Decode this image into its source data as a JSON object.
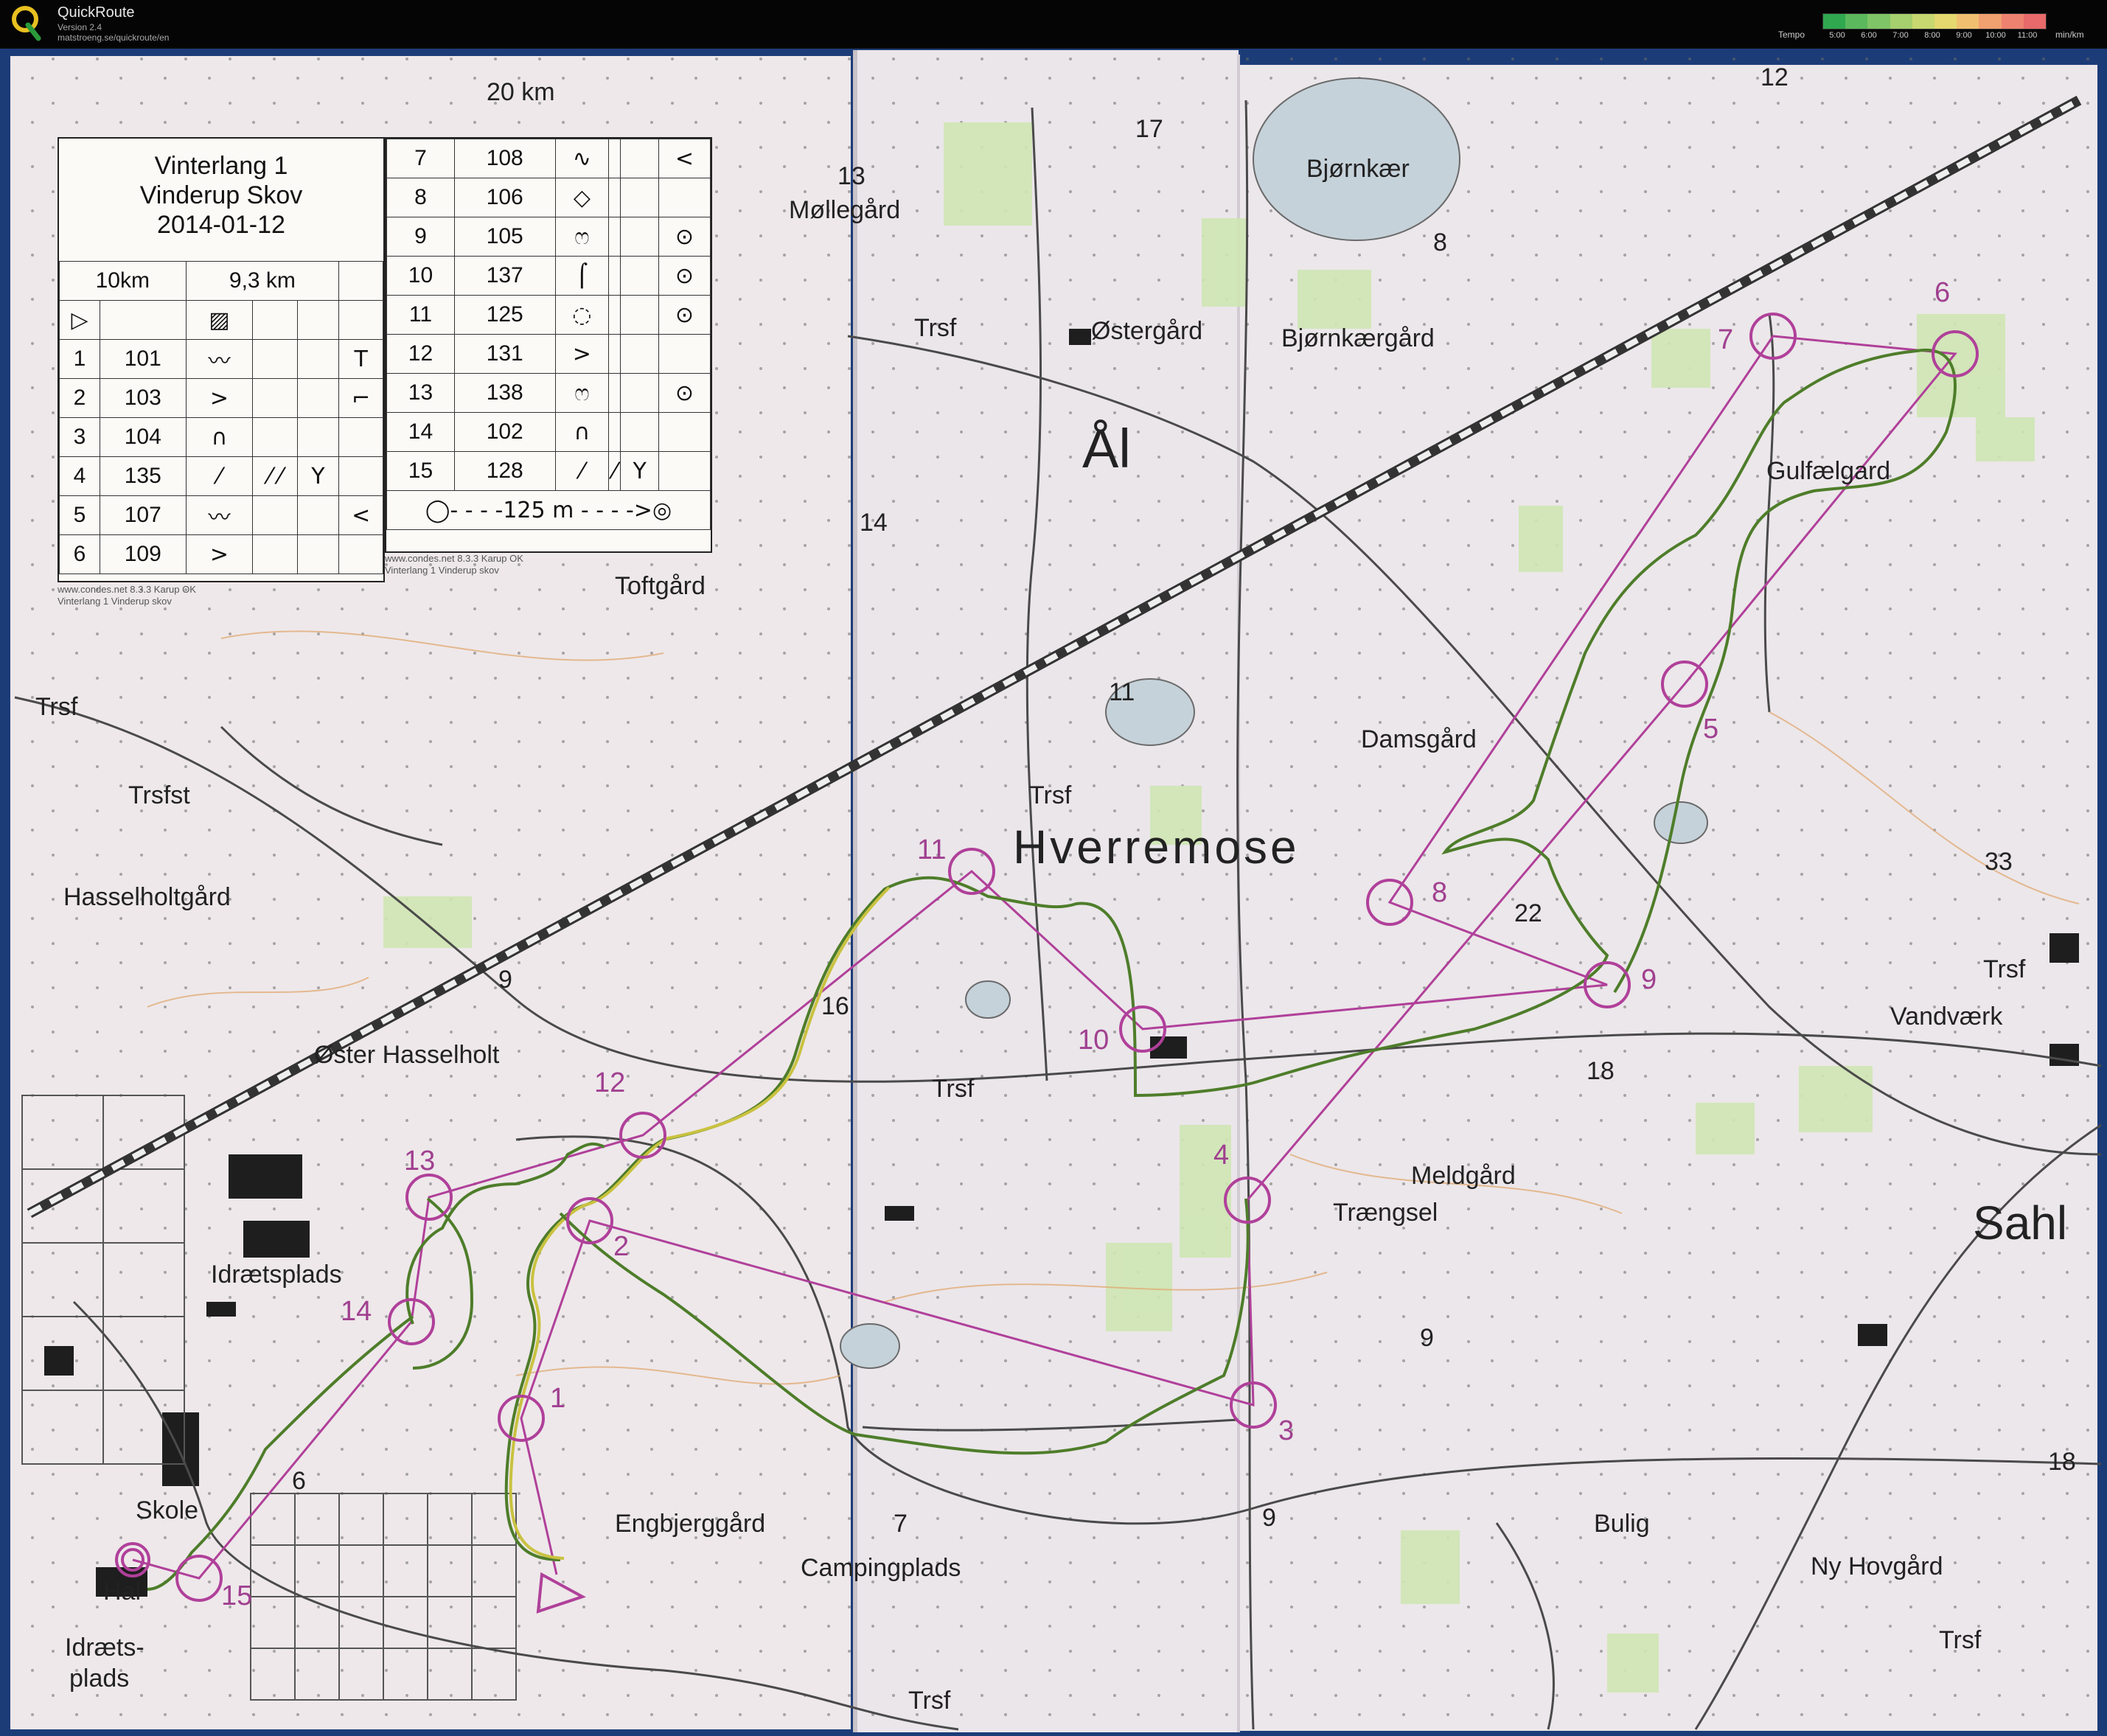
{
  "app": {
    "title": "QuickRoute",
    "version": "Version 2.4",
    "url": "matstroeng.se/quickroute/en"
  },
  "tempo": {
    "label": "Tempo",
    "unit": "min/km",
    "ticks": [
      "5:00",
      "6:00",
      "7:00",
      "8:00",
      "9:00",
      "10:00",
      "11:00"
    ],
    "colors": [
      "#2fa84f",
      "#5cb85c",
      "#7fc466",
      "#a6cf6e",
      "#c8d870",
      "#e4d86e",
      "#f0c070",
      "#f1a070",
      "#ee8270",
      "#e86a6a"
    ]
  },
  "legend": {
    "title1": "Vinterlang 1",
    "title2": "Vinderup Skov",
    "title3": "2014-01-12",
    "course_a": "10km",
    "course_b": "9,3 km",
    "start_symbol": "▷",
    "caption1": "www.condes.net 8.3.3 Karup OK",
    "caption2": "Vinterlang 1 Vinderup skov",
    "rows_left": [
      {
        "n": "1",
        "code": "101",
        "s1": "〰",
        "s2": "",
        "s3": "",
        "s4": "T"
      },
      {
        "n": "2",
        "code": "103",
        "s1": ">",
        "s2": "",
        "s3": "",
        "s4": "⌐"
      },
      {
        "n": "3",
        "code": "104",
        "s1": "∩",
        "s2": "",
        "s3": "",
        "s4": ""
      },
      {
        "n": "4",
        "code": "135",
        "s1": "⁄",
        "s2": "⁄ ⁄",
        "s3": "Y",
        "s4": ""
      },
      {
        "n": "5",
        "code": "107",
        "s1": "〰",
        "s2": "",
        "s3": "",
        "s4": "<"
      },
      {
        "n": "6",
        "code": "109",
        "s1": ">",
        "s2": "",
        "s3": "",
        "s4": ""
      }
    ],
    "rows_right": [
      {
        "n": "7",
        "code": "108",
        "s1": "∿",
        "s2": "",
        "s3": "",
        "s4": "<"
      },
      {
        "n": "8",
        "code": "106",
        "s1": "◇",
        "s2": "",
        "s3": "",
        "s4": ""
      },
      {
        "n": "9",
        "code": "105",
        "s1": "ෆ",
        "s2": "",
        "s3": "",
        "s4": "⊙"
      },
      {
        "n": "10",
        "code": "137",
        "s1": "⌠",
        "s2": "",
        "s3": "",
        "s4": "⊙"
      },
      {
        "n": "11",
        "code": "125",
        "s1": "◌",
        "s2": "",
        "s3": "",
        "s4": "⊙"
      },
      {
        "n": "12",
        "code": "131",
        "s1": ">",
        "s2": "",
        "s3": "",
        "s4": ""
      },
      {
        "n": "13",
        "code": "138",
        "s1": "ෆ",
        "s2": "",
        "s3": "",
        "s4": "⊙"
      },
      {
        "n": "14",
        "code": "102",
        "s1": "∩",
        "s2": "",
        "s3": "",
        "s4": ""
      },
      {
        "n": "15",
        "code": "128",
        "s1": "⁄",
        "s2": "⁄",
        "s3": "Y",
        "s4": ""
      }
    ],
    "finish_line": "◯- - - -125 m - - - ->◎"
  },
  "map_labels": {
    "km20": "20 km",
    "mollegard": "Møllegård",
    "trsf1": "Trsf",
    "ostergard": "Østergård",
    "bjornkaer": "Bjørnkær",
    "bjornkaergard": "Bjørnkærgård",
    "al": "Ål",
    "toftgard": "Toftgård",
    "gulfaelgard": "Gulfælgard",
    "trsf2": "Trsf",
    "trsfst": "Trsfst",
    "hasselholtgard": "Hasselholtgård",
    "trsf3": "Trsf",
    "hverremose": "Hverremose",
    "damsgard": "Damsgård",
    "oster_hasselholt": "Øster Hasselholt",
    "trsf4": "Trsf",
    "vandvaerk": "Vandværk",
    "trsf5": "Trsf",
    "idraetsplads": "Idrætsplads",
    "traengsel": "Trængsel",
    "meldgard": "Meldgård",
    "sahl": "Sahl",
    "skole": "Skole",
    "hal": "Hal",
    "idraetsplads2a": "Idræts-",
    "idraetsplads2b": "plads",
    "engbjerggard": "Engbjerggård",
    "campingplads": "Campingplads",
    "bulig": "Bulig",
    "ny_hovgard": "Ny Hovgård",
    "trsf6": "Trsf",
    "trsf7": "Trsf",
    "n13": "13",
    "n17": "17",
    "n8": "8",
    "n14": "14",
    "n11": "11",
    "n16": "16",
    "n9a": "9",
    "n22": "22",
    "n18a": "18",
    "n33": "33",
    "n9b": "9",
    "n9c": "9",
    "n6": "6",
    "n7": "7",
    "n18b": "18",
    "n12": "12"
  },
  "controls": [
    "1",
    "2",
    "3",
    "4",
    "5",
    "6",
    "7",
    "8",
    "9",
    "10",
    "11",
    "12",
    "13",
    "14",
    "15"
  ]
}
